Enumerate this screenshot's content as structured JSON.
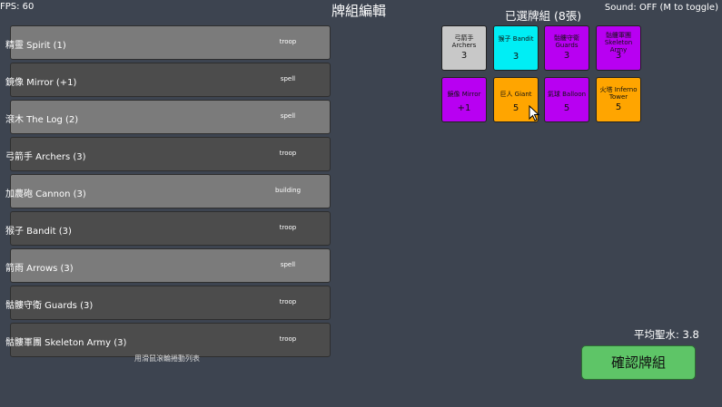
{
  "hud": {
    "fps": "FPS: 60",
    "title": "牌組編輯",
    "sound": "Sound: OFF (M to toggle)"
  },
  "card_list": {
    "items": [
      {
        "name": "精靈 Spirit (1)",
        "type": "troop"
      },
      {
        "name": "鏡像 Mirror (+1)",
        "type": "spell"
      },
      {
        "name": "滾木 The Log (2)",
        "type": "spell"
      },
      {
        "name": "弓箭手 Archers (3)",
        "type": "troop"
      },
      {
        "name": "加農砲 Cannon (3)",
        "type": "building"
      },
      {
        "name": "猴子 Bandit (3)",
        "type": "troop"
      },
      {
        "name": "箭雨 Arrows (3)",
        "type": "spell"
      },
      {
        "name": "骷髏守衛 Guards (3)",
        "type": "troop"
      },
      {
        "name": "骷髏軍團 Skeleton Army (3)",
        "type": "troop"
      }
    ],
    "scroll_hint": "用滑鼠滾輪捲動列表"
  },
  "deck": {
    "title": "已選牌組 (8張)",
    "cards": [
      {
        "name": "弓箭手 Archers",
        "cost": "3",
        "color": "#c8c8c8"
      },
      {
        "name": "猴子 Bandit",
        "cost": "3",
        "color": "#00eef5"
      },
      {
        "name": "骷髏守衛 Guards",
        "cost": "3",
        "color": "#b800f2"
      },
      {
        "name": "骷髏軍團 Skeleton Army",
        "cost": "3",
        "color": "#b800f2"
      },
      {
        "name": "鏡像 Mirror",
        "cost": "+1",
        "color": "#b800f2"
      },
      {
        "name": "巨人 Giant",
        "cost": "5",
        "color": "#ffa500"
      },
      {
        "name": "氣球 Balloon",
        "cost": "5",
        "color": "#b800f2"
      },
      {
        "name": "火塔 Inferno Tower",
        "cost": "5",
        "color": "#ffa500"
      }
    ],
    "average_elixir": "平均聖水: 3.8",
    "confirm_label": "確認牌組"
  }
}
